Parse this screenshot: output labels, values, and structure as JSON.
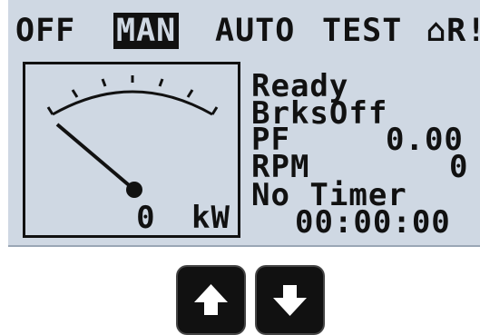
{
  "mode_bar": {
    "off": "OFF",
    "man": "MAN",
    "auto": "AUTO",
    "test": "TEST",
    "extra": "⌂R!"
  },
  "status": {
    "line1": "Ready",
    "line2": "BrksOff",
    "pf_label": "PF",
    "pf_value": "0.00",
    "rpm_label": "RPM",
    "rpm_value": "0",
    "timer_label": "No Timer",
    "timer_value": "00:00:00"
  },
  "gauge": {
    "value": "0",
    "unit": "kW"
  },
  "buttons": {
    "up": "up",
    "down": "down"
  }
}
